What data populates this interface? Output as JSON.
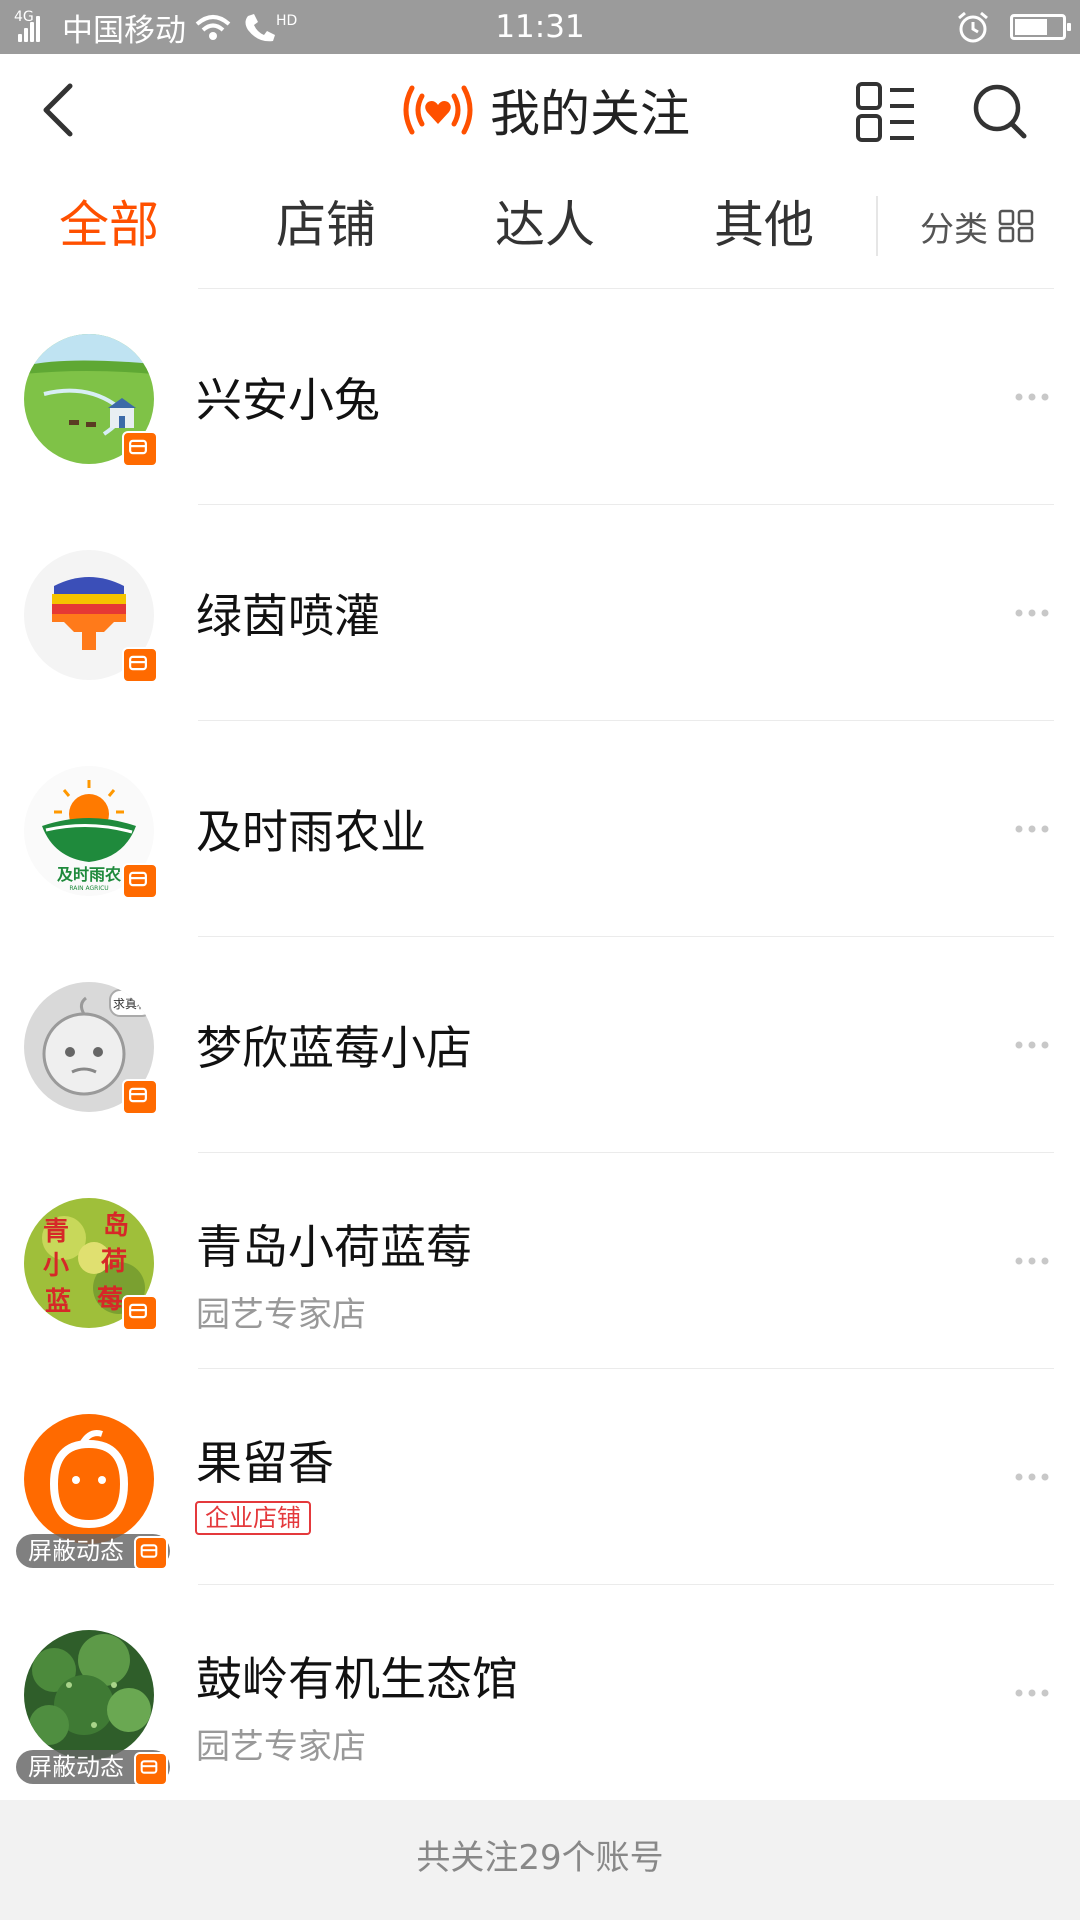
{
  "status_bar": {
    "network": "4G",
    "carrier": "中国移动",
    "hd": "HD",
    "time": "11:31",
    "battery_level": 0.7
  },
  "nav": {
    "title": "我的关注",
    "accent": "#ff5000"
  },
  "tabs": [
    {
      "label": "全部",
      "active": true
    },
    {
      "label": "店铺",
      "active": false
    },
    {
      "label": "达人",
      "active": false
    },
    {
      "label": "其他",
      "active": false
    }
  ],
  "category": {
    "label": "分类"
  },
  "follows": [
    {
      "name": "兴安小兔",
      "subtitle": "",
      "tag": "",
      "muted": false,
      "avatar": "grassland-yurt"
    },
    {
      "name": "绿茵喷灌",
      "subtitle": "",
      "tag": "",
      "muted": false,
      "avatar": "sprinkler-logo"
    },
    {
      "name": "及时雨农业",
      "subtitle": "",
      "tag": "",
      "muted": false,
      "avatar": "sunrise-logo",
      "avatar_text": "及时雨农",
      "avatar_subtext": "RAIN AGRICU"
    },
    {
      "name": "梦欣蓝莓小店",
      "subtitle": "",
      "tag": "",
      "muted": false,
      "avatar": "cartoon-face",
      "avatar_text": "求真相"
    },
    {
      "name": "青岛小荷蓝莓",
      "subtitle": "园艺专家店",
      "tag": "",
      "muted": false,
      "avatar": "calligraphy",
      "avatar_text": [
        "青",
        "岛",
        "小",
        "荷",
        "蓝",
        "莓"
      ]
    },
    {
      "name": "果留香",
      "subtitle": "",
      "tag": "企业店铺",
      "muted": true,
      "avatar": "orange-mascot"
    },
    {
      "name": "鼓岭有机生态馆",
      "subtitle": "园艺专家店",
      "tag": "",
      "muted": true,
      "avatar": "tea-bush"
    }
  ],
  "mute_label": "屏蔽动态",
  "footer": {
    "text": "共关注29个账号"
  }
}
